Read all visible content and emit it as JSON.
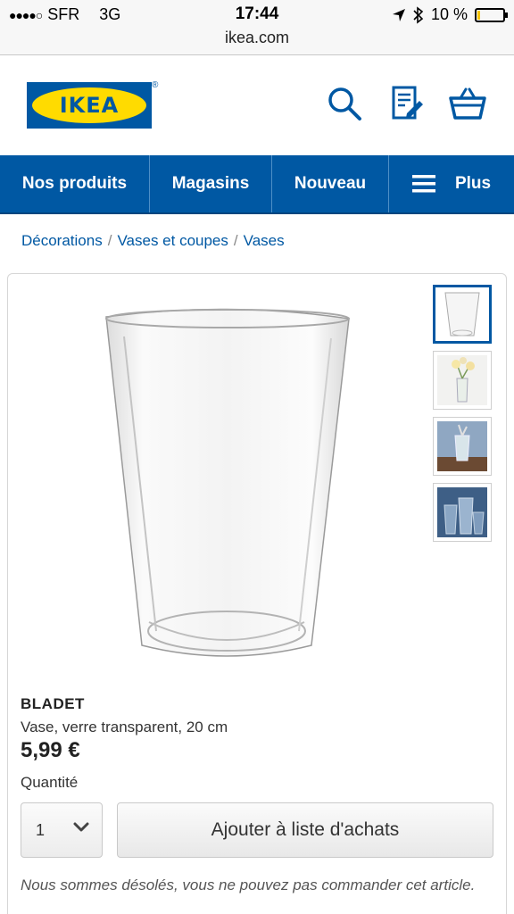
{
  "status_bar": {
    "carrier": "SFR",
    "network": "3G",
    "time": "17:44",
    "battery": "10 %",
    "battery_level": 0.1,
    "url": "ikea.com"
  },
  "header": {
    "logo_text": "IKEA",
    "logo_mark": "®",
    "icons": [
      "search-icon",
      "shopping-list-icon",
      "basket-icon"
    ]
  },
  "nav": {
    "items": [
      {
        "label": "Nos produits"
      },
      {
        "label": "Magasins"
      },
      {
        "label": "Nouveau"
      },
      {
        "label": "Plus",
        "icon": "menu-icon"
      }
    ]
  },
  "breadcrumb": {
    "items": [
      "Décorations",
      "Vases et coupes",
      "Vases"
    ],
    "separator": "/"
  },
  "product": {
    "name": "BLADET",
    "description": "Vase, verre transparent, 20 cm",
    "price": "5,99 €",
    "quantity_label": "Quantité",
    "quantity_value": "1",
    "add_button": "Ajouter à liste d'achats",
    "note": "Nous sommes désolés, vous ne pouvez pas commander cet article.",
    "thumbnails": [
      "vase-empty",
      "vase-with-flowers",
      "vase-on-shelf",
      "vases-group"
    ]
  },
  "colors": {
    "brand_blue": "#0058a3",
    "brand_yellow": "#ffdb00"
  }
}
